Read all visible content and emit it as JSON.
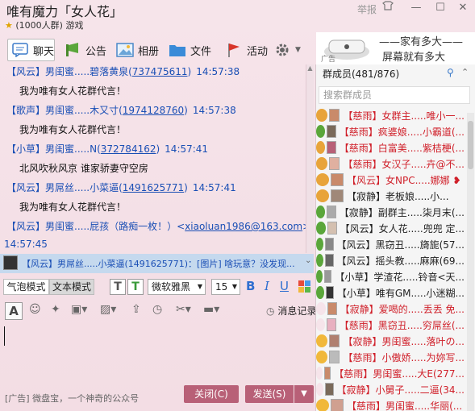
{
  "window": {
    "title": "唯有魔力「女人花」",
    "subtitle_count": "(1000人群)",
    "subtitle_category": "游戏",
    "report": "举报",
    "colors": {
      "accent": "#b86077",
      "link": "#1a4fb5",
      "background": "#f6e4ea"
    }
  },
  "toolbar": {
    "chat": "聊天",
    "announce": "公告",
    "album": "相册",
    "files": "文件",
    "activity": "活动"
  },
  "ad_banner": {
    "line1": "——家有多大——",
    "line2": "屏幕就有多大",
    "tag": "广告"
  },
  "messages": [
    {
      "tag": "【风云】",
      "name": "男闺蜜.....碧落黄泉",
      "qq": "737475611",
      "time": "14:57:38",
      "text": "我为唯有女人花群代言！"
    },
    {
      "tag": "【歌声】",
      "name": "男闺蜜.....木又寸",
      "qq": "1974128760",
      "time": "14:57:38",
      "text": "我为唯有女人花群代言！"
    },
    {
      "tag": "【小草】",
      "name": "男闺蜜.....N",
      "qq": "372784162",
      "time": "14:57:41",
      "text": "北风吹秋风京 谁家骄妻守空房"
    },
    {
      "tag": "【风云】",
      "name": "男屌丝.....小菜逼",
      "qq": "1491625771",
      "time": "14:57:41",
      "text": "我为唯有女人花群代言！"
    },
    {
      "tag": "【风云】",
      "name": "男闺蜜.....屁孩（路痴一枚！）",
      "qq": "xiaoluan1986@163.com",
      "time": "14:57:45",
      "text": ""
    }
  ],
  "notice": "【风云】男屌丝.....小菜逼(1491625771)：[图片] 啥玩意？没发现...",
  "input_bar": {
    "mode_bubble": "气泡模式",
    "mode_text": "文本模式",
    "font": "微软雅黑",
    "size": "15",
    "history": "消息记录"
  },
  "bottom": {
    "ad_text": "[广告] 微盘宝，一个神奇的公众号",
    "close": "关闭(C)",
    "send": "发送(S)"
  },
  "members_panel": {
    "title": "群成员(481/876)",
    "search_placeholder": "搜索群成员",
    "members": [
      {
        "tag": "【慈雨】",
        "name": "女群主.....唯小一...",
        "color": "#d0202a"
      },
      {
        "tag": "【慈雨】",
        "name": "疯婆娘.....小霸道(...",
        "color": "#d0202a"
      },
      {
        "tag": "【慈雨】",
        "name": "白富美.....紫桔梗(...",
        "color": "#d0202a"
      },
      {
        "tag": "【慈雨】",
        "name": "女汉子.....卉@不...",
        "color": "#d0202a"
      },
      {
        "tag": "【风云】",
        "name": "女NPC.....娜娜 ❥",
        "color": "#d0202a"
      },
      {
        "tag": "【寂静】",
        "name": "老板娘.....小...",
        "color": "#222222"
      },
      {
        "tag": "【寂静】",
        "name": "副群主.....柒月末(...",
        "color": "#222222"
      },
      {
        "tag": "【风云】",
        "name": "女人花.....兜兜 定...",
        "color": "#222222"
      },
      {
        "tag": "【风云】",
        "name": "黑窃丑.....旖旎(57...",
        "color": "#222222"
      },
      {
        "tag": "【风云】",
        "name": "摇头教.....麻麻(69...",
        "color": "#222222"
      },
      {
        "tag": "【小草】",
        "name": "学渣花.....铃音<天...",
        "color": "#222222"
      },
      {
        "tag": "【小草】",
        "name": "唯有GM.....小迷糊...",
        "color": "#222222"
      },
      {
        "tag": "【寂静】",
        "name": "爱喝的.....丢丢 免...",
        "color": "#d0202a"
      },
      {
        "tag": "【慈雨】",
        "name": "黑窃丑.....穷屌丝(...",
        "color": "#d0202a"
      },
      {
        "tag": "【寂静】",
        "name": "男闺蜜.....落叶の...",
        "color": "#d0202a"
      },
      {
        "tag": "【慈雨】",
        "name": "小傲娇.....为妳写...",
        "color": "#d0202a"
      },
      {
        "tag": "【慈雨】",
        "name": "男闺蜜.....大E(277...",
        "color": "#d0202a"
      },
      {
        "tag": "【寂静】",
        "name": "小舅子.....二逼(34...",
        "color": "#d0202a"
      },
      {
        "tag": "【慈雨】",
        "name": "男闺蜜.....华丽(...",
        "color": "#d0202a"
      }
    ]
  }
}
